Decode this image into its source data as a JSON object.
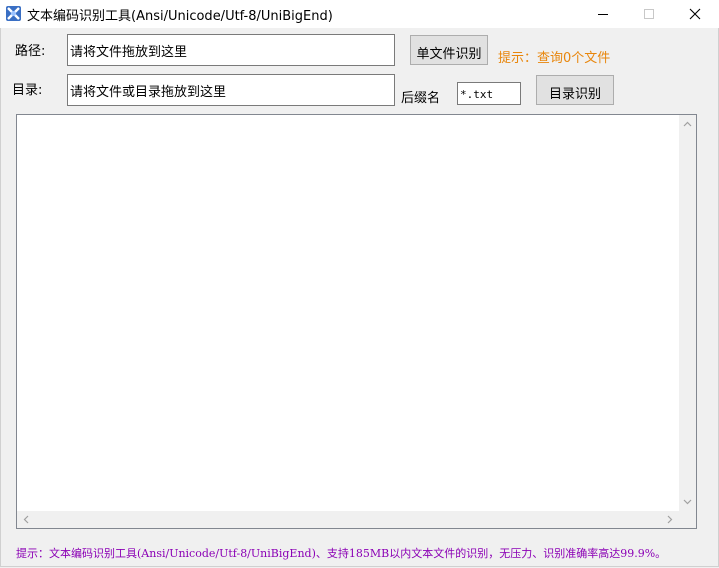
{
  "window": {
    "title": "文本编码识别工具(Ansi/Unicode/Utf-8/UniBigEnd)",
    "icon": "app-icon"
  },
  "path_row": {
    "label": "路径:",
    "value": "请将文件拖放到这里",
    "button_label": "单文件识别",
    "hint": "提示：查询0个文件"
  },
  "dir_row": {
    "label": "目录:",
    "value": "请将文件或目录拖放到这里",
    "suffix_label": "后缀名",
    "suffix_value": "*.txt",
    "button_label": "目录识别"
  },
  "results": {
    "items": []
  },
  "status": {
    "text": "提示：文本编码识别工具(Ansi/Unicode/Utf-8/UniBigEnd)、支持185MB以内文本文件的识别，无压力、识别准确率高达99.9%。"
  },
  "colors": {
    "hint_orange": "#e8860c",
    "status_purple": "#8b00b5"
  }
}
